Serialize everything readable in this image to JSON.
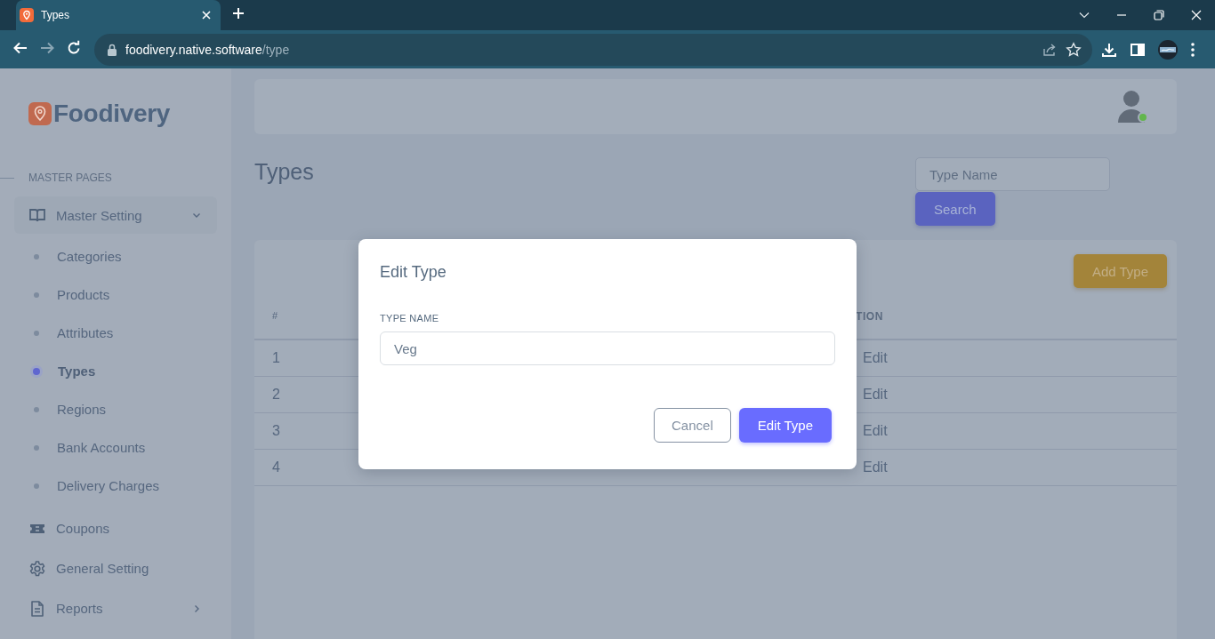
{
  "browser": {
    "tab_title": "Types",
    "url_host": "foodivery.native.software",
    "url_path": "/type"
  },
  "sidebar": {
    "brand": "Foodivery",
    "section": "MASTER PAGES",
    "items": [
      {
        "label": "Master Setting",
        "kind": "book",
        "expanded": true,
        "children": [
          {
            "label": "Categories",
            "selected": false
          },
          {
            "label": "Products",
            "selected": false
          },
          {
            "label": "Attributes",
            "selected": false
          },
          {
            "label": "Types",
            "selected": true
          },
          {
            "label": "Regions",
            "selected": false
          },
          {
            "label": "Bank Accounts",
            "selected": false
          },
          {
            "label": "Delivery Charges",
            "selected": false
          }
        ]
      },
      {
        "label": "Coupons",
        "kind": "ticket"
      },
      {
        "label": "General Setting",
        "kind": "gear"
      },
      {
        "label": "Reports",
        "kind": "file",
        "expanded": false
      }
    ]
  },
  "page": {
    "title": "Types",
    "search": {
      "placeholder": "Type Name",
      "button": "Search"
    },
    "add_button": "Add Type"
  },
  "table": {
    "columns": [
      "#",
      "TION"
    ],
    "rows": [
      {
        "number": "1",
        "action": "Edit"
      },
      {
        "number": "2",
        "action": "Edit"
      },
      {
        "number": "3",
        "action": "Edit"
      },
      {
        "number": "4",
        "action": "Edit"
      }
    ]
  },
  "modal": {
    "title": "Edit Type",
    "field_label": "TYPE NAME",
    "field_value": "Veg",
    "cancel": "Cancel",
    "submit": "Edit Type"
  }
}
